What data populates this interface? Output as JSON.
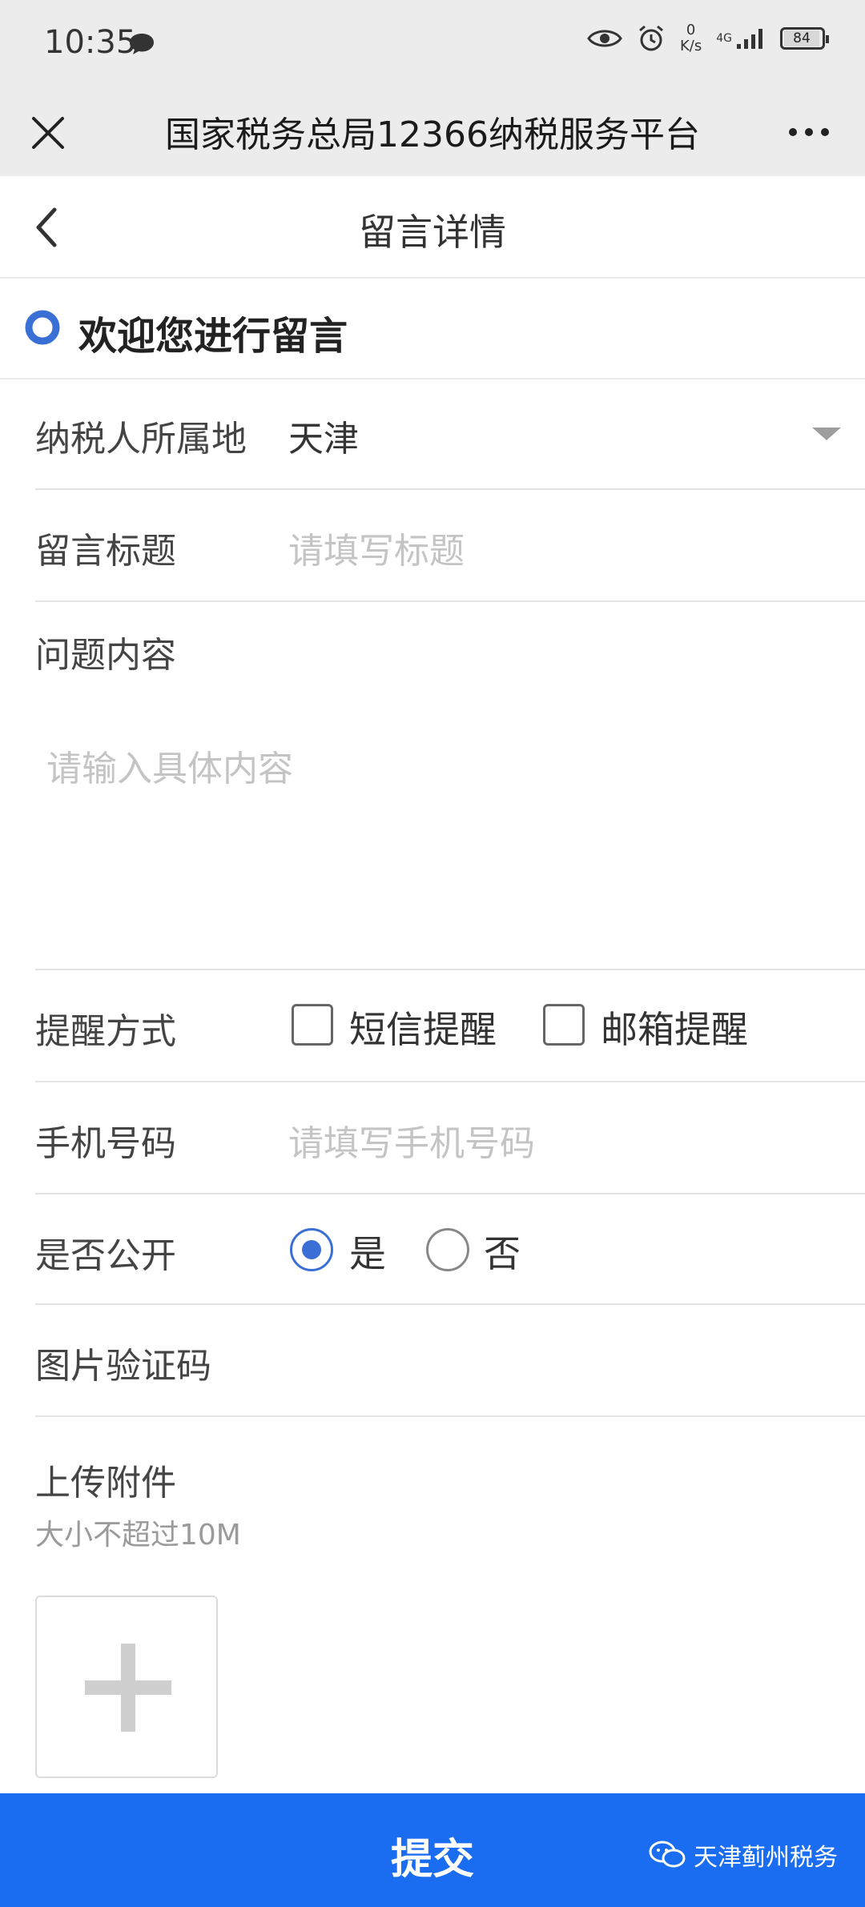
{
  "status_bar": {
    "time": "10:35",
    "net_speed_value": "0",
    "net_speed_unit": "K/s",
    "network": "4G",
    "battery": "84"
  },
  "wechat_bar": {
    "title": "国家税务总局12366纳税服务平台"
  },
  "page": {
    "title": "留言详情"
  },
  "welcome": {
    "text": "欢迎您进行留言"
  },
  "form": {
    "location": {
      "label": "纳税人所属地",
      "value": "天津"
    },
    "subject": {
      "label": "留言标题",
      "placeholder": "请填写标题"
    },
    "content": {
      "label": "问题内容",
      "placeholder": "请输入具体内容"
    },
    "reminder": {
      "label": "提醒方式",
      "sms": "短信提醒",
      "email": "邮箱提醒"
    },
    "phone": {
      "label": "手机号码",
      "placeholder": "请填写手机号码"
    },
    "public": {
      "label": "是否公开",
      "yes": "是",
      "no": "否"
    },
    "captcha": {
      "label": "图片验证码"
    },
    "attachment": {
      "label": "上传附件",
      "hint": "大小不超过10M"
    }
  },
  "submit_label": "提交",
  "watermark": "天津蓟州税务",
  "colors": {
    "accent": "#1a6cf0",
    "radio_blue": "#3a70d6"
  }
}
